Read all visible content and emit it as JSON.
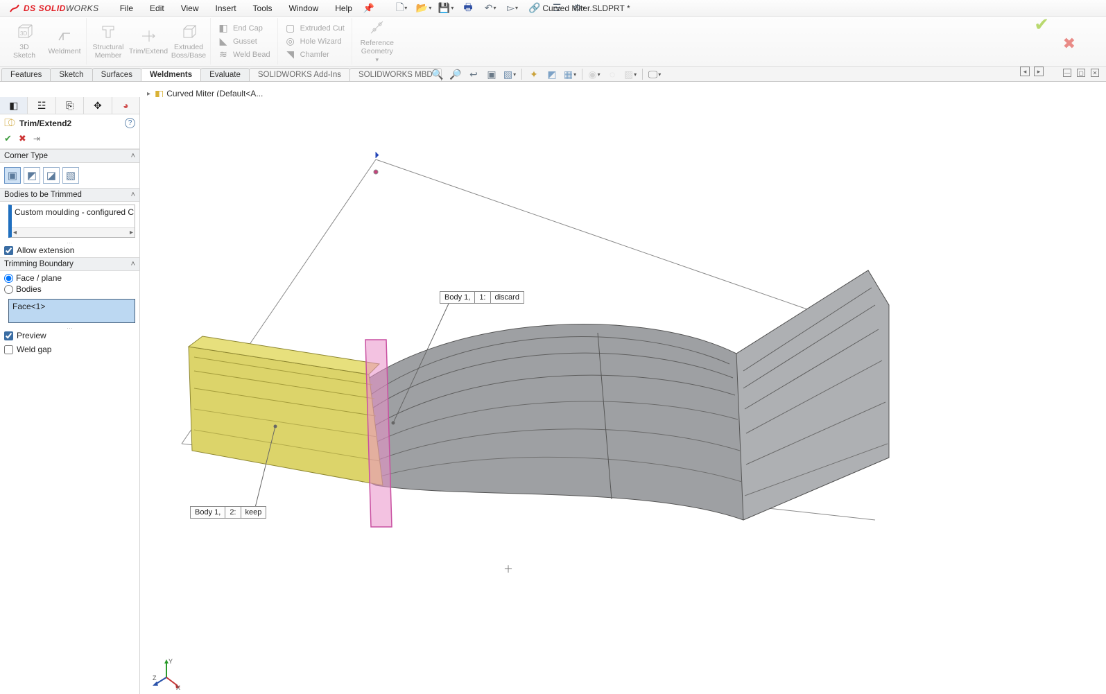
{
  "app": {
    "brand_pre": "DS",
    "brand": "SOLIDWORKS",
    "doc_title": "Curved Miter.SLDPRT *",
    "menus": [
      "File",
      "Edit",
      "View",
      "Insert",
      "Tools",
      "Window",
      "Help"
    ]
  },
  "ribbon": {
    "buttons": {
      "sketch3d": "3D\nSketch",
      "weldment": "Weldment",
      "structural": "Structural\nMember",
      "trimextend": "Trim/Extend",
      "extrudedboss": "Extruded\nBoss/Base",
      "endcap": "End Cap",
      "gusset": "Gusset",
      "weldbead": "Weld Bead",
      "extrudedcut": "Extruded Cut",
      "holewizard": "Hole Wizard",
      "chamfer": "Chamfer",
      "refgeom": "Reference\nGeometry"
    }
  },
  "tabs": [
    "Features",
    "Sketch",
    "Surfaces",
    "Weldments",
    "Evaluate",
    "SOLIDWORKS Add-Ins",
    "SOLIDWORKS MBD"
  ],
  "tabs_active": "Weldments",
  "breadcrumb": "Curved Miter  (Default<A...",
  "property": {
    "feature_name": "Trim/Extend2",
    "sections": {
      "corner_type": "Corner Type",
      "bodies": "Bodies to be Trimmed",
      "trim_boundary": "Trimming Boundary"
    },
    "body_item": "Custom moulding - configured CUSTO",
    "allow_extension": "Allow extension",
    "face_plane": "Face / plane",
    "bodies_radio": "Bodies",
    "face_sel": "Face<1>",
    "preview": "Preview",
    "weld_gap": "Weld gap"
  },
  "callouts": {
    "discard": {
      "l1": "Body  1,",
      "l2": "1:",
      "l3": "discard"
    },
    "keep": {
      "l1": "Body  1,",
      "l2": "2:",
      "l3": "keep"
    }
  },
  "triad": {
    "x": "X",
    "y": "Y",
    "z": "Z"
  }
}
